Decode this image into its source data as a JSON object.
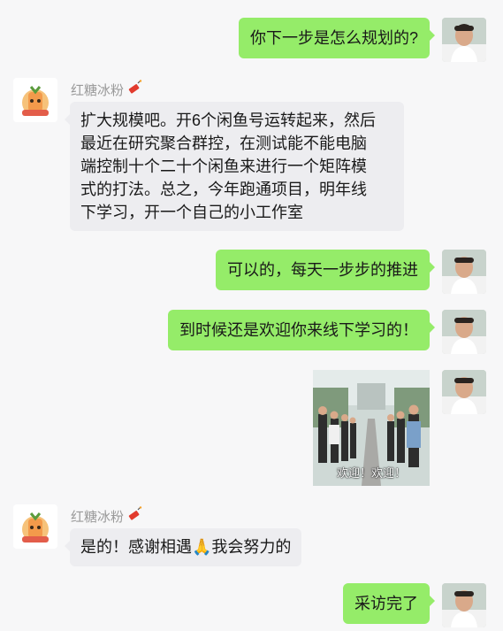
{
  "contact": {
    "name": "红糖冰粉",
    "badge_icon": "firecracker-icon"
  },
  "messages": [
    {
      "from": "self",
      "text": "你下一步是怎么规划的?"
    },
    {
      "from": "other",
      "lines": [
        "扩大规模吧。开6个闲鱼号运转起来，然后",
        "最近在研究聚合群控，在测试能不能电脑",
        "端控制十个二十个闲鱼来进行一个矩阵模",
        "式的打法。总之，今年跑通项目，明年线",
        "下学习，开一个自己的小工作室"
      ]
    },
    {
      "from": "self",
      "text": "可以的，每天一步步的推进"
    },
    {
      "from": "self",
      "text": "到时候还是欢迎你来线下学习的！"
    },
    {
      "from": "self",
      "type": "image",
      "caption": "欢迎！欢迎！"
    },
    {
      "from": "other",
      "text_before": "是的！感谢相遇",
      "emoji": "🙏",
      "text_after": "我会努力的"
    },
    {
      "from": "self",
      "text": "采访完了"
    }
  ],
  "colors": {
    "self_bubble": "#95ec69",
    "other_bubble": "#ededf0",
    "background": "#f7f7f8"
  }
}
